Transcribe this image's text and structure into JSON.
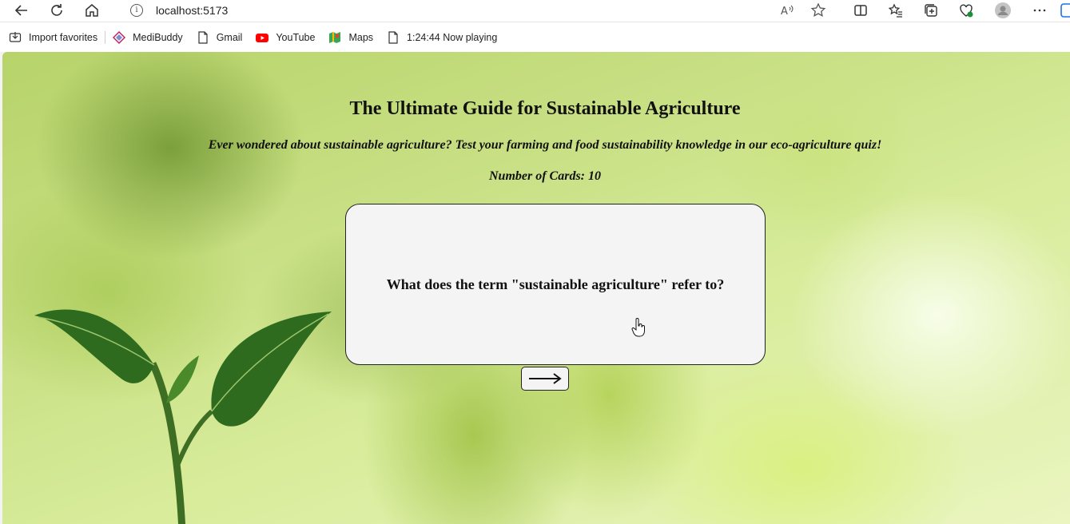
{
  "browser": {
    "url": "localhost:5173",
    "bookmarks": [
      {
        "label": "Import favorites",
        "icon": "import-icon"
      },
      {
        "label": "MediBuddy",
        "icon": "medibuddy-icon"
      },
      {
        "label": "Gmail",
        "icon": "page-icon"
      },
      {
        "label": "YouTube",
        "icon": "youtube-icon"
      },
      {
        "label": "Maps",
        "icon": "maps-icon"
      },
      {
        "label": "1:24:44 Now playing",
        "icon": "page-icon"
      }
    ]
  },
  "quiz": {
    "title": "The Ultimate Guide for Sustainable Agriculture",
    "subtitle": "Ever wondered about sustainable agriculture? Test your farming and food sustainability knowledge in our eco-agriculture quiz!",
    "card_count": "Number of Cards: 10",
    "question": "What does the term \"sustainable agriculture\" refer to?"
  },
  "colors": {
    "card_background": "#f4f4f4",
    "youtube_red": "#ff0000",
    "leaf_green": "#2f6b1f"
  }
}
